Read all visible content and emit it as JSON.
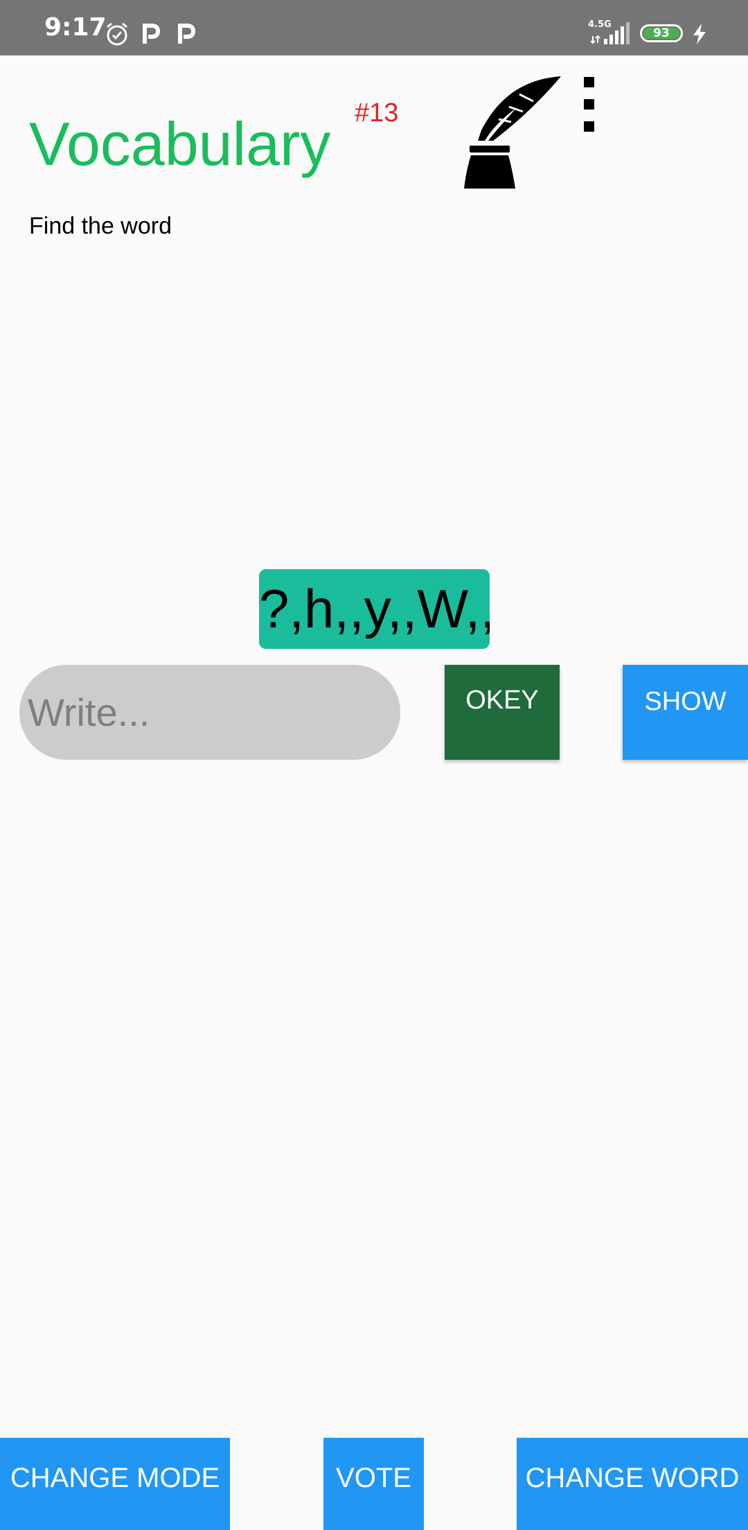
{
  "status_bar": {
    "time": "9:17",
    "network": "4.5G",
    "battery_level": "93",
    "icons": [
      "alarm-icon",
      "p-icon",
      "p-icon",
      "signal-icon",
      "battery-icon",
      "charging-bolt-icon"
    ]
  },
  "header": {
    "title": "Vocabulary",
    "puzzle_number": "#13",
    "logo_icon": "quill-and-inkwell-icon",
    "menu_icon": "overflow-menu-icon"
  },
  "subtitle": "Find the word",
  "hint": "?,h,,y,,W,,,",
  "answer": {
    "value": "",
    "placeholder": "Write..."
  },
  "buttons": {
    "okey": "OKEY",
    "show": "SHOW",
    "change_mode": "CHANGE MODE",
    "vote": "VOTE",
    "change_word": "CHANGE WORD"
  },
  "colors": {
    "status_bar": "#757575",
    "title": "#1abc5c",
    "puzzle_number": "#e0261d",
    "hint_background": "#1abc9c",
    "okey_button": "#1f6b3b",
    "primary_button": "#2196f3",
    "input_background": "#cccccc",
    "battery": "#4caf50"
  }
}
